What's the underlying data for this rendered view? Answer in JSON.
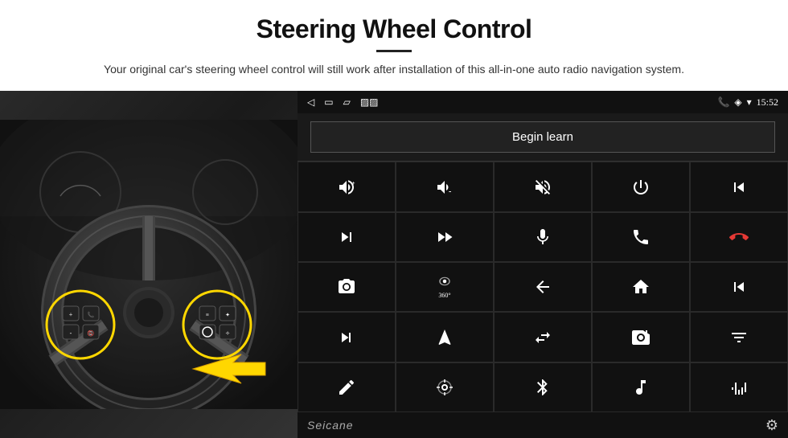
{
  "header": {
    "title": "Steering Wheel Control",
    "subtitle": "Your original car's steering wheel control will still work after installation of this all-in-one auto radio navigation system."
  },
  "status_bar": {
    "time": "15:52",
    "icons": [
      "phone",
      "location",
      "wifi",
      "signal"
    ]
  },
  "begin_learn_button": "Begin learn",
  "control_grid": [
    [
      {
        "icon": "vol_up_plus",
        "symbol": "🔊+"
      },
      {
        "icon": "vol_down_minus",
        "symbol": "🔊-"
      },
      {
        "icon": "mute",
        "symbol": "🔇"
      },
      {
        "icon": "power",
        "symbol": "⏻"
      },
      {
        "icon": "prev_track",
        "symbol": "⏮"
      }
    ],
    [
      {
        "icon": "next_skip",
        "symbol": "⏭"
      },
      {
        "icon": "fast_forward",
        "symbol": "⏩"
      },
      {
        "icon": "mic",
        "symbol": "🎤"
      },
      {
        "icon": "phone_call",
        "symbol": "📞"
      },
      {
        "icon": "phone_end",
        "symbol": "📵"
      }
    ],
    [
      {
        "icon": "camera",
        "symbol": "📷"
      },
      {
        "icon": "360_view",
        "symbol": "360°"
      },
      {
        "icon": "back",
        "symbol": "↩"
      },
      {
        "icon": "home",
        "symbol": "⌂"
      },
      {
        "icon": "skip_back",
        "symbol": "⏮"
      }
    ],
    [
      {
        "icon": "fast_fwd",
        "symbol": "⏭"
      },
      {
        "icon": "nav_arrow",
        "symbol": "▲"
      },
      {
        "icon": "swap",
        "symbol": "⇄"
      },
      {
        "icon": "radio",
        "symbol": "📻"
      },
      {
        "icon": "eq",
        "symbol": "⚙"
      }
    ],
    [
      {
        "icon": "edit",
        "symbol": "✏"
      },
      {
        "icon": "satellite",
        "symbol": "⊙"
      },
      {
        "icon": "bluetooth",
        "symbol": "⚡"
      },
      {
        "icon": "music",
        "symbol": "♫"
      },
      {
        "icon": "waveform",
        "symbol": "|||"
      }
    ]
  ],
  "bottom": {
    "brand": "Seicane"
  }
}
